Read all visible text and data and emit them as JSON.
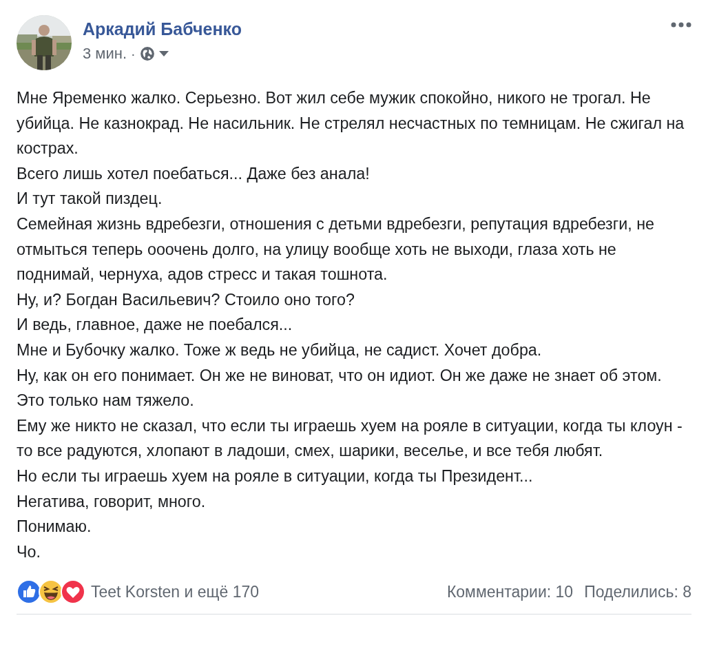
{
  "post": {
    "author": "Аркадий Бабченко",
    "time": "3 мин.",
    "separator": "·",
    "paragraphs": [
      "Мне Яременко жалко. Серьезно. Вот жил себе мужик спокойно, никого не трогал. Не убийца. Не казнокрад. Не насильник. Не стрелял несчастных по темницам. Не сжигал на кострах.",
      "Всего лишь хотел поебаться... Даже без анала!",
      "И тут такой пиздец.",
      "Семейная жизнь вдребезги, отношения с детьми вдребезги, репутация вдребезги, не отмыться теперь ооочень долго, на улицу вообще хоть не выходи, глаза хоть не поднимай, чернуха, адов стресс и такая тошнота.",
      "Ну, и? Богдан Васильевич? Стоило оно того?",
      "И ведь, главное, даже не поебался...",
      "Мне и Бубочку жалко. Тоже ж ведь не убийца, не садист. Хочет добра.",
      "Ну, как он его понимает. Он же не виноват, что он идиот. Он же даже не знает об этом. Это только нам тяжело.",
      "Ему же никто не сказал, что если ты играешь хуем на рояле в ситуации, когда ты клоун - то все радуются, хлопают в ладоши, смех, шарики, веселье, и все тебя любят.",
      "Но если ты играешь хуем на рояле в ситуации, когда ты Президент...",
      "Негатива, говорит, много.",
      "Понимаю.",
      "Чо."
    ]
  },
  "footer": {
    "reactions": "Teet Korsten и ещё 170",
    "comments": "Комментарии: 10",
    "shares": "Поделились: 8"
  }
}
